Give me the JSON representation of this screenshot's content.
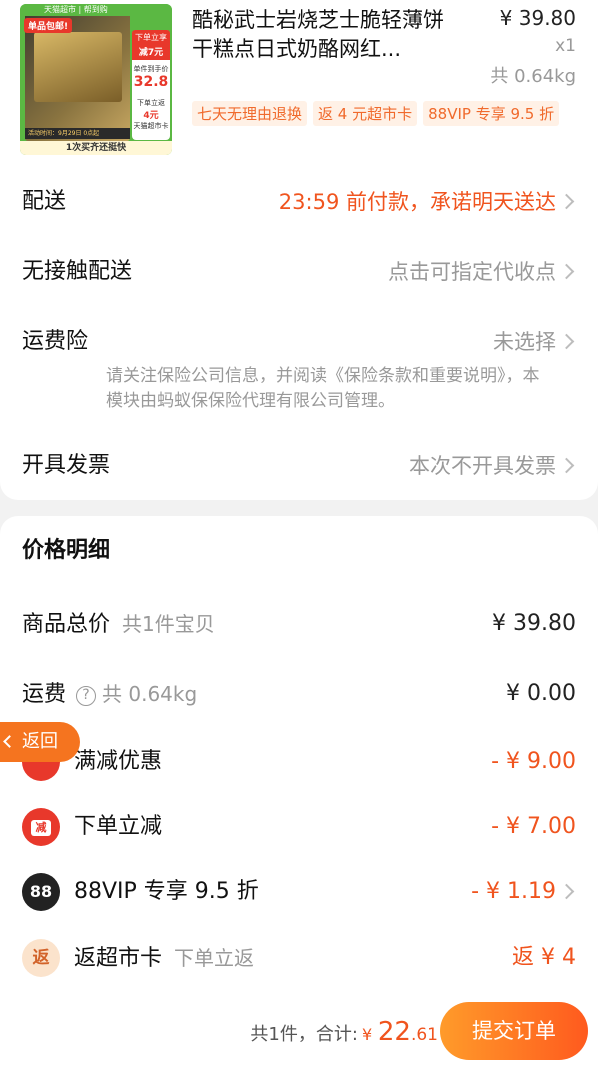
{
  "product": {
    "title": "酷秘武士岩烧芝士脆轻薄饼干糕点日式奶酪网红...",
    "price": "¥ 39.80",
    "qty": "x1",
    "weight": "共 0.64kg",
    "image": {
      "top_banner": "天猫超市 | 帮到购",
      "red_tag": "单品包邮!",
      "promo_1": "下单立享",
      "promo_2": "减7元",
      "after_label": "单件到手价",
      "after_price": "32.8",
      "rebate_1": "下单立返",
      "rebate_2": "4元",
      "rebate_3": "天猫超市卡",
      "strip": "活动时间：9月29日 0点起",
      "bottom": "1次买齐还挺快"
    },
    "badges": [
      "七天无理由退换",
      "返 4 元超市卡",
      "88VIP 专享 9.5 折"
    ]
  },
  "shipping": {
    "delivery_label": "配送",
    "delivery_value": "23:59 前付款，承诺明天送达",
    "contactless_label": "无接触配送",
    "contactless_value": "点击可指定代收点",
    "insurance_label": "运费险",
    "insurance_value": "未选择",
    "insurance_note": "请关注保险公司信息，并阅读《保险条款和重要说明》，本模块由蚂蚁保保险代理有限公司管理。",
    "invoice_label": "开具发票",
    "invoice_value": "本次不开具发票"
  },
  "price_detail": {
    "title": "价格明细",
    "goods_label": "商品总价",
    "goods_sub": "共1件宝贝",
    "goods_value": "¥ 39.80",
    "freight_label": "运费",
    "freight_q": "?",
    "freight_sub": "共 0.64kg",
    "freight_value": "¥ 0.00",
    "discount_label": "满减优惠",
    "discount_value": "- ¥ 9.00",
    "instant_icon": "减",
    "instant_label": "下单立减",
    "instant_value": "- ¥ 7.00",
    "vip_icon": "88",
    "vip_label": "88VIP 专享 9.5 折",
    "vip_value": "- ¥ 1.19",
    "rebate_icon": "返",
    "rebate_label": "返超市卡",
    "rebate_sub": "下单立返",
    "rebate_value": "返 ¥ 4"
  },
  "back_label": "返回",
  "footer": {
    "count": "共1件，",
    "total_label": "合计:",
    "currency": "¥",
    "amount_int": "22",
    "amount_dec": ".61",
    "submit": "提交订单"
  },
  "colors": {
    "accent": "#f0541e",
    "button_start": "#ff9b2a",
    "button_end": "#ff5a1e"
  }
}
